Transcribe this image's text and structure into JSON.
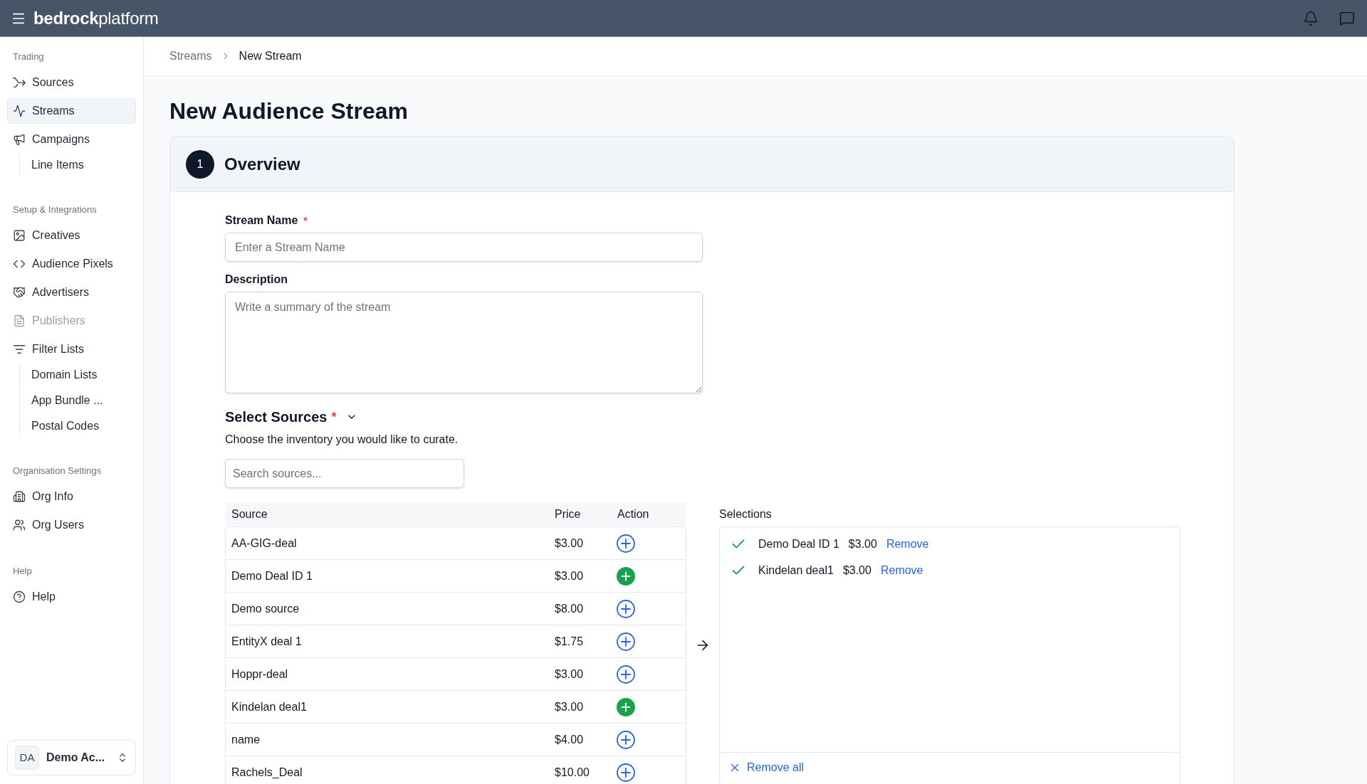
{
  "header": {
    "logo": "**bedrock**platform"
  },
  "sidebar": {
    "sections": [
      {
        "title": "Trading",
        "items": [
          {
            "label": "Sources",
            "selected": false,
            "disabled": false
          },
          {
            "label": "Streams",
            "selected": true,
            "disabled": false
          },
          {
            "label": "Campaigns",
            "selected": false,
            "disabled": false,
            "children": [
              {
                "label": "Line Items",
                "selected": false,
                "disabled": false
              }
            ]
          }
        ]
      },
      {
        "title": "Setup & Integrations",
        "items": [
          {
            "label": "Creatives",
            "selected": false,
            "disabled": false
          },
          {
            "label": "Audience Pixels",
            "selected": false,
            "disabled": false
          },
          {
            "label": "Advertisers",
            "selected": false,
            "disabled": false
          },
          {
            "label": "Publishers",
            "selected": false,
            "disabled": true
          },
          {
            "label": "Filter Lists",
            "selected": false,
            "disabled": false,
            "children": [
              {
                "label": "Domain Lists",
                "selected": false,
                "disabled": false
              },
              {
                "label": "App Bundle ...",
                "selected": false,
                "disabled": false
              },
              {
                "label": "Postal Codes",
                "selected": false,
                "disabled": false
              }
            ]
          }
        ]
      },
      {
        "title": "Organisation Settings",
        "items": [
          {
            "label": "Org Info",
            "selected": false,
            "disabled": false
          },
          {
            "label": "Org Users",
            "selected": false,
            "disabled": false
          }
        ]
      },
      {
        "title": "Help",
        "items": [
          {
            "label": "Help",
            "selected": false,
            "disabled": false
          }
        ]
      }
    ],
    "account": {
      "initials": "DA",
      "name": "Demo Ac..."
    }
  },
  "breadcrumbs": [
    {
      "label": "Streams",
      "current": false
    },
    {
      "label": "New Stream",
      "current": true
    }
  ],
  "page_title": "New Audience Stream",
  "step": {
    "number": "1",
    "title": "Overview"
  },
  "form": {
    "fields": [
      {
        "kind": "input",
        "label": "Stream Name",
        "required_mark": "*",
        "placeholder": "Enter a Stream Name"
      },
      {
        "kind": "textarea",
        "label": "Description",
        "placeholder": "Write a summary of the stream"
      }
    ],
    "sources": {
      "title": "Select Sources",
      "required_mark": "*",
      "expanded": true,
      "description": "Choose the inventory you would like to curate.",
      "search": {
        "placeholder": "Search sources..."
      },
      "table": {
        "columns": [
          "Source",
          "Price",
          "Action"
        ],
        "rows": [
          {
            "source": "AA-GIG-deal",
            "price": "$3.00",
            "selected": false
          },
          {
            "source": "Demo Deal ID 1",
            "price": "$3.00",
            "selected": true
          },
          {
            "source": "Demo source",
            "price": "$8.00",
            "selected": false
          },
          {
            "source": "EntityX deal 1",
            "price": "$1.75",
            "selected": false
          },
          {
            "source": "Hoppr-deal",
            "price": "$3.00",
            "selected": false
          },
          {
            "source": "Kindelan deal1",
            "price": "$3.00",
            "selected": true
          },
          {
            "source": "name",
            "price": "$4.00",
            "selected": false
          },
          {
            "source": "Rachels_Deal",
            "price": "$10.00",
            "selected": false
          }
        ]
      },
      "selections": {
        "title": "Selections",
        "items": [
          {
            "source": "Demo Deal ID 1",
            "price": "$3.00",
            "action": "Remove"
          },
          {
            "source": "Kindelan deal1",
            "price": "$3.00",
            "action": "Remove"
          }
        ],
        "footer_action": "Remove all"
      }
    }
  }
}
